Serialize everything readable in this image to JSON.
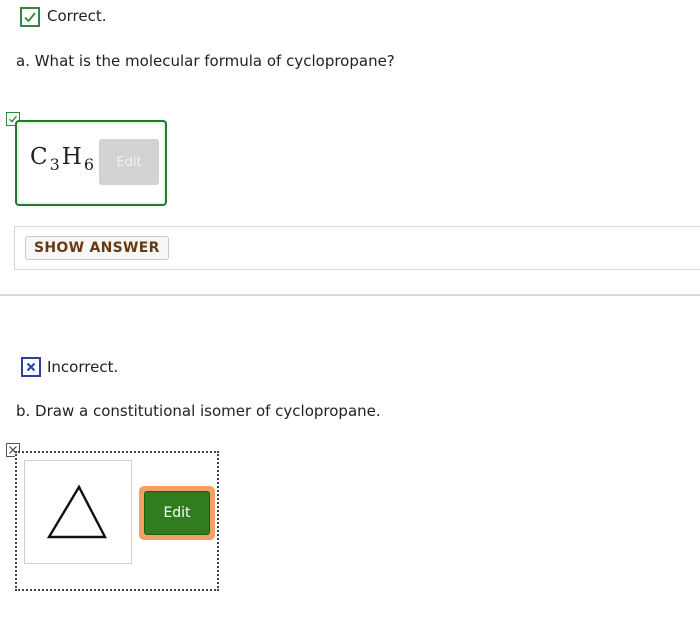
{
  "part_a": {
    "status_text": "Correct.",
    "question": "a. What is the molecular formula of cyclopropane?",
    "formula": {
      "c": "C",
      "c_sub": "3",
      "h": "H",
      "h_sub": "6"
    },
    "edit_label": "Edit",
    "show_answer_label": "SHOW ANSWER"
  },
  "part_b": {
    "status_text": "Incorrect.",
    "question": "b. Draw a constitutional isomer of cyclopropane.",
    "edit_label": "Edit"
  },
  "colors": {
    "correct": "#2f8a3a",
    "incorrect": "#2b3fa8",
    "edit_active": "#2f7d1f",
    "edit_focus_ring": "#f2a064",
    "show_answer_text": "#6a3b12"
  }
}
